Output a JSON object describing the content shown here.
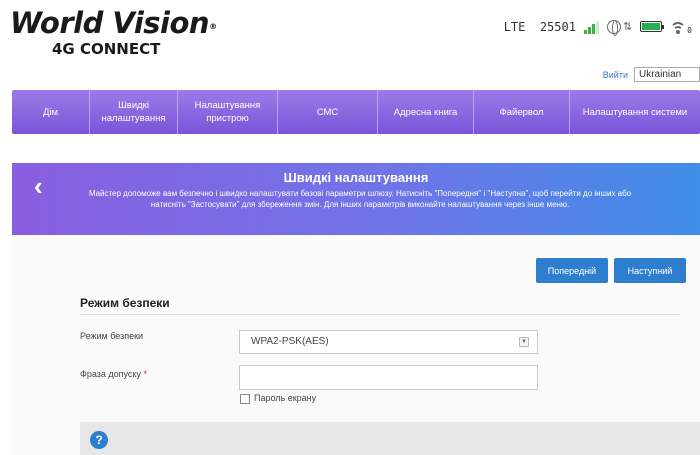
{
  "brand": {
    "name": "World Vision",
    "registered": "®",
    "subtitle": "4G CONNECT"
  },
  "status": {
    "network_type": "LTE",
    "operator_code": "25501",
    "signal_level": 0.8,
    "battery_level": 1.0,
    "wifi_clients": "0"
  },
  "header": {
    "logout_label": "Вийти",
    "language": "Ukrainian"
  },
  "nav": {
    "items": [
      {
        "label": "Дім"
      },
      {
        "label": "Швидкі налаштування"
      },
      {
        "label": "Налаштування пристрою"
      },
      {
        "label": "СМС"
      },
      {
        "label": "Адресна книга"
      },
      {
        "label": "Файервол"
      },
      {
        "label": "Налаштування системи"
      }
    ]
  },
  "banner": {
    "title": "Швидкі налаштування",
    "description": "Майстер допоможе вам безпечно і швидко налаштувати базові параметри шлюзу. Натисніть \"Попередня\" і \"Наступна\", щоб перейти до інших або натисніть \"Застосувати\" для збереження змін. Для інших параметрів виконайте налаштування через інше меню."
  },
  "buttons": {
    "prev_label": "Попередній",
    "next_label": "Наступний"
  },
  "form": {
    "section_title": "Режим безпеки",
    "security_mode_label": "Режим безпеки",
    "security_mode_value": "WPA2-PSK(AES)",
    "passphrase_label": "Фраза допуску",
    "required_mark": "*",
    "passphrase_value": "",
    "show_password_label": "Пароль екрану"
  },
  "help": {
    "icon": "question-icon",
    "symbol": "?"
  },
  "colors": {
    "nav": "#8a68e0",
    "accent": "#2e7ed0",
    "signal": "#3cb43c",
    "battery": "#22b14c"
  }
}
